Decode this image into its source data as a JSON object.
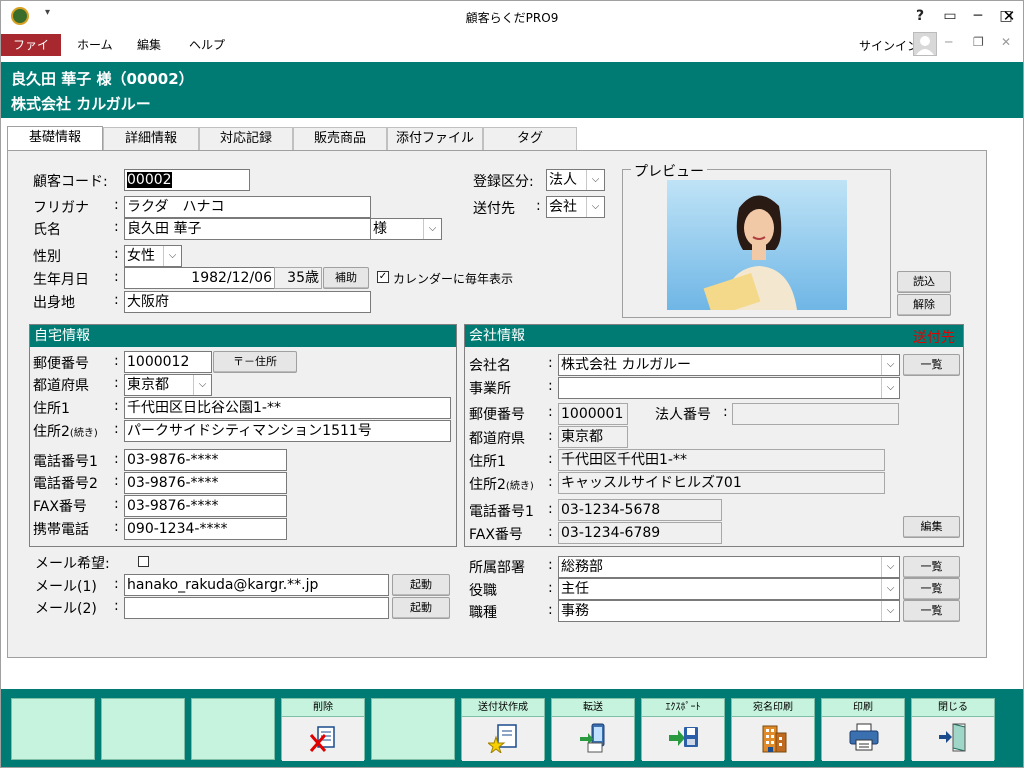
{
  "window": {
    "title": "顧客らくだPRO9",
    "help": "?"
  },
  "menu": {
    "items": [
      "ファイル",
      "ホーム",
      "編集",
      "ヘルプ"
    ],
    "signin": "サインイン"
  },
  "header": {
    "line1": "良久田 華子 様（00002）",
    "line2": "株式会社 カルガルー"
  },
  "tabs": [
    "基礎情報",
    "詳細情報",
    "対応記録",
    "販売商品",
    "添付ファイル",
    "タグ"
  ],
  "basic": {
    "customer_code_label": "顧客コード:",
    "customer_code": "00002",
    "furigana_label": "フリガナ",
    "furigana": "ラクダ　ハナコ",
    "name_label": "氏名",
    "name": "良久田 華子",
    "honorific": "様",
    "gender_label": "性別",
    "gender": "女性",
    "birthday_label": "生年月日",
    "birthday": "1982/12/06",
    "age": "35歳",
    "assist_btn": "補助",
    "calendar_label": "カレンダーに毎年表示",
    "birthplace_label": "出身地",
    "birthplace": "大阪府",
    "reg_label": "登録区分:",
    "reg_value": "法人",
    "send_label": "送付先",
    "send_value": "会社",
    "preview_label": "プレビュー",
    "load_btn": "読込",
    "clear_btn": "解除"
  },
  "home": {
    "title": "自宅情報",
    "zip_label": "郵便番号",
    "zip": "1000012",
    "zip_btn": "〒－住所",
    "pref_label": "都道府県",
    "pref": "東京都",
    "addr1_label": "住所1",
    "addr1": "千代田区日比谷公園1-**",
    "addr2_label": "住所2",
    "addr2_small": "(続き)",
    "addr2": "パークサイドシティマンション1511号",
    "tel1_label": "電話番号1",
    "tel1": "03-9876-****",
    "tel2_label": "電話番号2",
    "tel2": "03-9876-****",
    "fax_label": "FAX番号",
    "fax": "03-9876-****",
    "mobile_label": "携帯電話",
    "mobile": "090-1234-****"
  },
  "mail": {
    "wish_label": "メール希望:",
    "mail1_label": "メール(1)",
    "mail1": "hanako_rakuda@kargr.**.jp",
    "mail2_label": "メール(2)",
    "mail2": "",
    "launch_btn": "起動"
  },
  "company": {
    "title": "会社情報",
    "send_mark": "送付先",
    "name_label": "会社名",
    "name": "株式会社 カルガルー",
    "list_btn": "一覧",
    "office_label": "事業所",
    "office": "",
    "zip_label": "郵便番号",
    "zip": "1000001",
    "corp_no_label": "法人番号",
    "corp_no": "",
    "pref_label": "都道府県",
    "pref": "東京都",
    "addr1_label": "住所1",
    "addr1": "千代田区千代田1-**",
    "addr2_label": "住所2",
    "addr2_small": "(続き)",
    "addr2": "キャッスルサイドヒルズ701",
    "tel_label": "電話番号1",
    "tel": "03-1234-5678",
    "fax_label": "FAX番号",
    "fax": "03-1234-6789",
    "edit_btn": "編集"
  },
  "dept": {
    "dept_label": "所属部署",
    "dept": "総務部",
    "title_label": "役職",
    "title": "主任",
    "job_label": "職種",
    "job": "事務",
    "list_btn": "一覧"
  },
  "fkeys": [
    "",
    "",
    "",
    "削除",
    "",
    "送付状作成",
    "転送",
    "ｴｸｽﾎﾟｰﾄ",
    "宛名印刷",
    "印刷",
    "閉じる"
  ],
  "colors": {
    "teal": "#007b73",
    "menu_active": "#a7282e",
    "fkey": "#c6f3dd"
  }
}
